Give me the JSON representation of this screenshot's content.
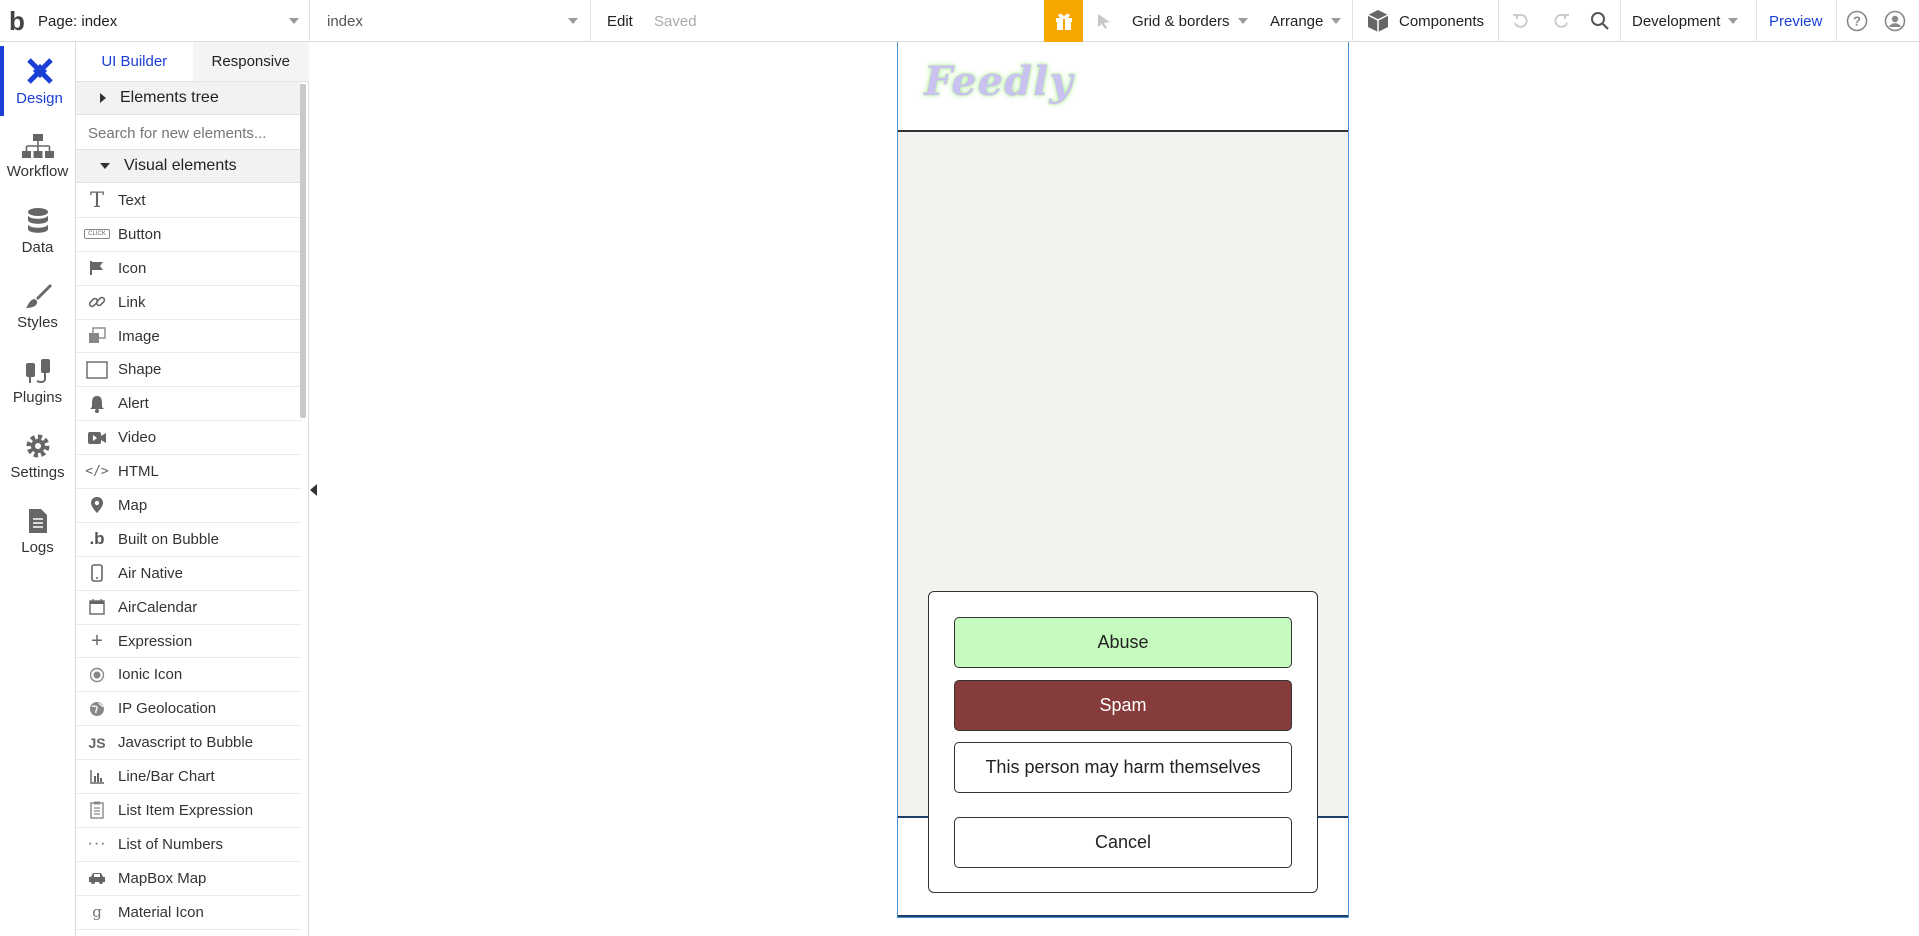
{
  "topbar": {
    "logo": "b",
    "page_selector": "Page: index",
    "index_selector": "index",
    "edit": "Edit",
    "saved": "Saved",
    "grid_borders": "Grid & borders",
    "arrange": "Arrange",
    "components": "Components",
    "development": "Development",
    "preview": "Preview"
  },
  "rail": {
    "items": [
      {
        "label": "Design",
        "icon": "design-icon"
      },
      {
        "label": "Workflow",
        "icon": "workflow-icon"
      },
      {
        "label": "Data",
        "icon": "database-icon"
      },
      {
        "label": "Styles",
        "icon": "brush-icon"
      },
      {
        "label": "Plugins",
        "icon": "plug-icon"
      },
      {
        "label": "Settings",
        "icon": "gear-icon"
      },
      {
        "label": "Logs",
        "icon": "document-icon"
      }
    ]
  },
  "panel": {
    "tabs": [
      "UI Builder",
      "Responsive"
    ],
    "elements_tree": "Elements tree",
    "search_placeholder": "Search for new elements...",
    "visual_elements": "Visual elements",
    "elements": [
      {
        "label": "Text",
        "icon": "text-icon"
      },
      {
        "label": "Button",
        "icon": "button-icon"
      },
      {
        "label": "Icon",
        "icon": "flag-icon"
      },
      {
        "label": "Link",
        "icon": "link-icon"
      },
      {
        "label": "Image",
        "icon": "image-icon"
      },
      {
        "label": "Shape",
        "icon": "shape-icon"
      },
      {
        "label": "Alert",
        "icon": "bell-icon"
      },
      {
        "label": "Video",
        "icon": "video-icon"
      },
      {
        "label": "HTML",
        "icon": "code-icon"
      },
      {
        "label": "Map",
        "icon": "map-pin-icon"
      },
      {
        "label": "Built on Bubble",
        "icon": "bubble-logo-icon"
      },
      {
        "label": "Air Native",
        "icon": "phone-icon"
      },
      {
        "label": "AirCalendar",
        "icon": "calendar-icon"
      },
      {
        "label": "Expression",
        "icon": "plus-icon"
      },
      {
        "label": "Ionic Icon",
        "icon": "radio-icon"
      },
      {
        "label": "IP Geolocation",
        "icon": "globe-icon"
      },
      {
        "label": "Javascript to Bubble",
        "icon": "js-icon"
      },
      {
        "label": "Line/Bar Chart",
        "icon": "bar-chart-icon"
      },
      {
        "label": "List Item Expression",
        "icon": "clipboard-icon"
      },
      {
        "label": "List of Numbers",
        "icon": "dots-icon"
      },
      {
        "label": "MapBox Map",
        "icon": "car-icon"
      },
      {
        "label": "Material Icon",
        "icon": "material-icon"
      }
    ]
  },
  "canvas": {
    "app_logo": "Feedly",
    "modal": {
      "abuse": "Abuse",
      "spam": "Spam",
      "harm": "This person may harm themselves",
      "cancel": "Cancel"
    }
  },
  "colors": {
    "accent": "#1a3fd6",
    "gift": "#f7a800",
    "abuse_bg": "#c6fbbf",
    "spam_bg": "#873c3c"
  }
}
